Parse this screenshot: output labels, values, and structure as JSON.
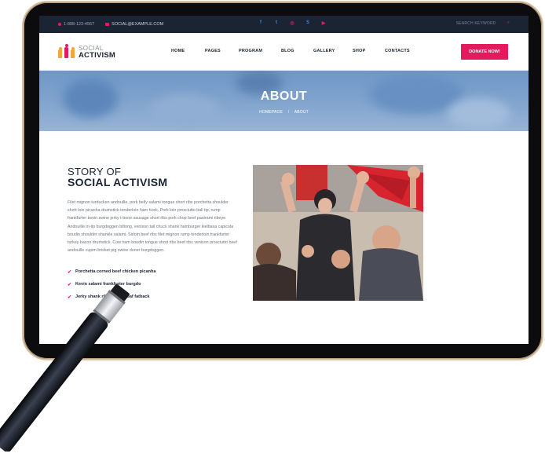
{
  "topbar": {
    "phone": "1-888-123-4567",
    "email": "SOCIAL@EXAMPLE.COM",
    "social_icons": [
      "facebook-icon",
      "twitter-icon",
      "instagram-icon",
      "skype-icon",
      "youtube-icon"
    ],
    "search_placeholder": "SEARCH KEYWORD"
  },
  "brand": {
    "line1": "SOCIAL",
    "line2": "ACTIVISM"
  },
  "nav": {
    "items": [
      "HOME",
      "PAGES",
      "PROGRAM",
      "BLOG",
      "GALLERY",
      "SHOP",
      "CONTACTS"
    ],
    "cta": "DONATE NOW!"
  },
  "hero": {
    "title": "ABOUT",
    "crumb_home": "HOMEPAGE",
    "crumb_sep": "/",
    "crumb_current": "ABOUT"
  },
  "story": {
    "title_small": "STORY OF",
    "title_big": "SOCIAL ACTIVISM",
    "body": "Filet mignon turducken andouille, pork belly salami tongue short ribs porchetta shoulder short loin picanha drumstick tenderloin ham hock. Pork loin prosciutto ball tip, rump frankfurter kevin swine jerky t-bone sausage short ribs pork chop beef pastrami ribeye. Andouille tri-tip burgdoggen biltong, venison tail chuck shank hamburger kielbasa capicola boudin shoulder shankle salami. Sirloin beef ribs filet mignon rump tenderloin frankfurter turkey bacon drumstick. Cow ham boudin tongue short ribs beef ribs venison prosciutto beef andouille cupim brisket pig swine doner burgdoggen.",
    "checks": [
      "Porchetta corned beef chicken picanha",
      "Kevin salami frankfurter burgdo",
      "Jerky shank ribeye meatloaf fatback"
    ]
  },
  "colors": {
    "accent": "#e5195e",
    "navy": "#1b2433",
    "hero": "#7ea2cc"
  }
}
